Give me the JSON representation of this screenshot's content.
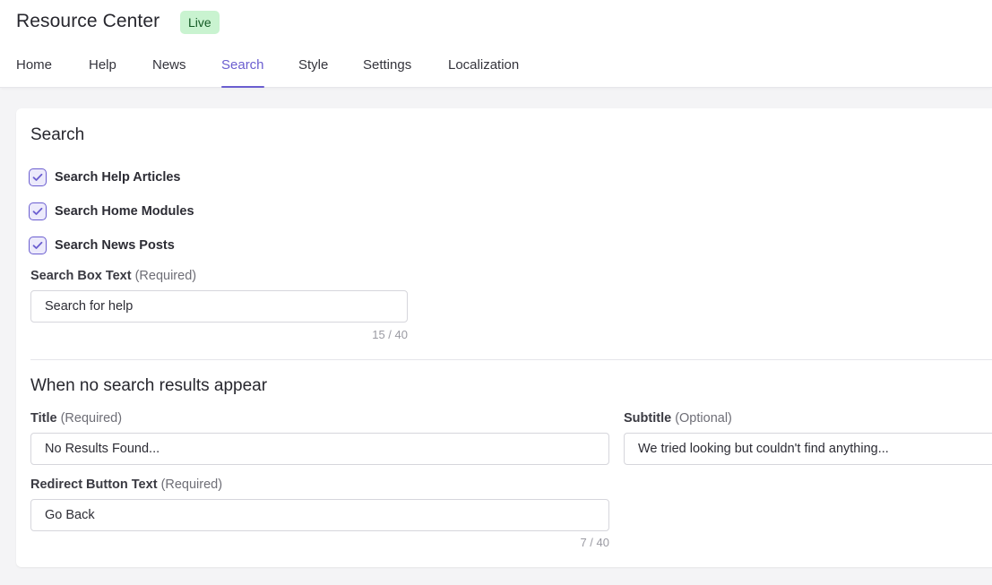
{
  "header": {
    "title": "Resource Center",
    "status_badge": "Live",
    "tabs": [
      {
        "label": "Home"
      },
      {
        "label": "Help"
      },
      {
        "label": "News"
      },
      {
        "label": "Search",
        "active": true
      },
      {
        "label": "Style"
      },
      {
        "label": "Settings"
      },
      {
        "label": "Localization"
      }
    ]
  },
  "search_section": {
    "title": "Search",
    "checkboxes": [
      {
        "label": "Search Help Articles",
        "checked": true
      },
      {
        "label": "Search Home Modules",
        "checked": true
      },
      {
        "label": "Search News Posts",
        "checked": true
      }
    ],
    "search_box": {
      "label": "Search Box Text",
      "required_text": "(Required)",
      "value": "Search for help",
      "counter": "15 / 40"
    }
  },
  "no_results_section": {
    "title": "When no search results appear",
    "title_field": {
      "label": "Title",
      "required_text": "(Required)",
      "value": "No Results Found..."
    },
    "subtitle_field": {
      "label": "Subtitle",
      "required_text": "(Optional)",
      "value": "We tried looking but couldn't find anything..."
    },
    "redirect_field": {
      "label": "Redirect Button Text",
      "required_text": "(Required)",
      "value": "Go Back",
      "counter": "7 / 40"
    }
  },
  "colors": {
    "accent": "#6b5ed0",
    "badge_bg": "#c9f3d0",
    "badge_text": "#145a24"
  },
  "icons": {
    "checkbox": "check-icon"
  }
}
